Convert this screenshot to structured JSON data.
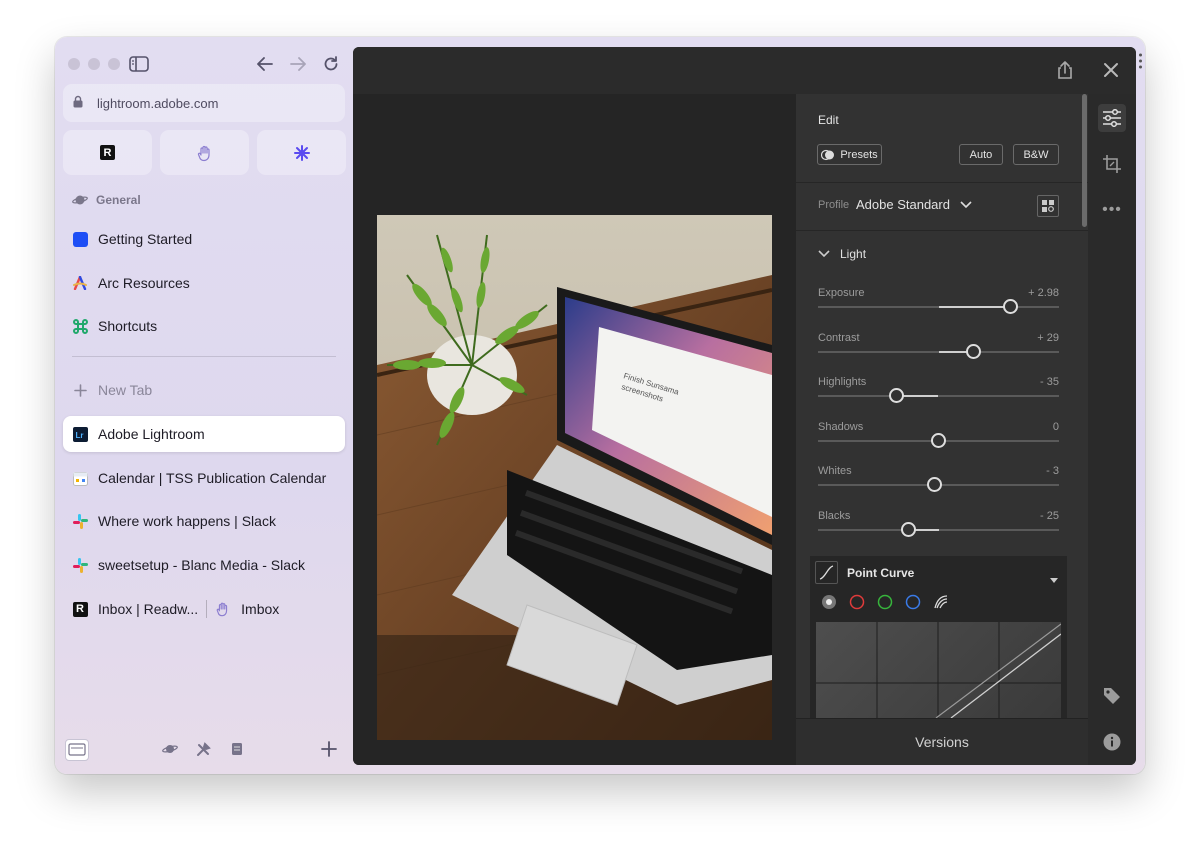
{
  "browser": {
    "url": "lightroom.adobe.com",
    "folder": "General",
    "items": [
      {
        "label": "Getting Started"
      },
      {
        "label": "Arc Resources"
      },
      {
        "label": "Shortcuts"
      }
    ],
    "new_tab": "New Tab",
    "tabs": [
      {
        "label": "Adobe Lightroom"
      },
      {
        "label": "Calendar | TSS Publication Calendar"
      },
      {
        "label": "Where work happens | Slack"
      },
      {
        "label": "sweetsetup - Blanc Media - Slack"
      }
    ],
    "split": {
      "left": "Inbox | Readw...",
      "right": "Imbox"
    }
  },
  "lightroom": {
    "edit_title": "Edit",
    "presets": "Presets",
    "auto": "Auto",
    "bw": "B&W",
    "profile_label": "Profile",
    "profile_value": "Adobe Standard",
    "light_section": "Light",
    "sliders": [
      {
        "label": "Exposure",
        "display": "+ 2.98",
        "value": 2.98,
        "min": -5,
        "max": 5
      },
      {
        "label": "Contrast",
        "display": "+ 29",
        "value": 29,
        "min": -100,
        "max": 100
      },
      {
        "label": "Highlights",
        "display": "- 35",
        "value": -35,
        "min": -100,
        "max": 100
      },
      {
        "label": "Shadows",
        "display": "0",
        "value": 0,
        "min": -100,
        "max": 100
      },
      {
        "label": "Whites",
        "display": "- 3",
        "value": -3,
        "min": -100,
        "max": 100
      },
      {
        "label": "Blacks",
        "display": "- 25",
        "value": -25,
        "min": -100,
        "max": 100
      }
    ],
    "point_curve": "Point Curve",
    "versions": "Versions"
  },
  "photo_screen": {
    "line1": "Finish Sunsama",
    "line2": "screenshots"
  }
}
